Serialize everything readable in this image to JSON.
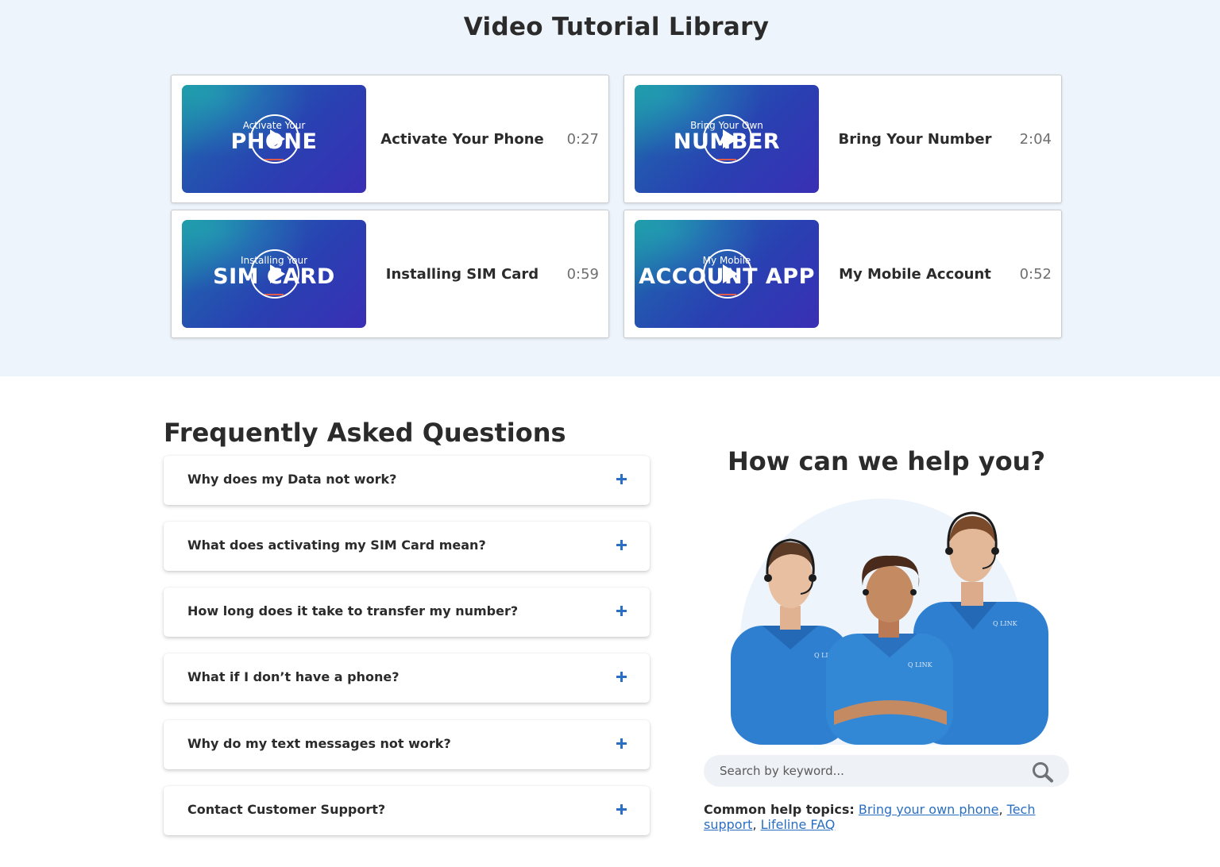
{
  "video_library": {
    "title": "Video Tutorial Library",
    "videos": [
      {
        "thumb_small": "Activate Your",
        "thumb_big": "PHONE",
        "name": "Activate Your Phone",
        "duration": "0:27"
      },
      {
        "thumb_small": "Bring Your Own",
        "thumb_big": "NUMBER",
        "name": "Bring Your Number",
        "duration": "2:04"
      },
      {
        "thumb_small": "Installing Your",
        "thumb_big": "SIM CARD",
        "name": "Installing SIM Card",
        "duration": "0:59"
      },
      {
        "thumb_small": "My Mobile",
        "thumb_big": "ACCOUNT APP",
        "name": "My Mobile Account",
        "duration": "0:52"
      }
    ]
  },
  "faq": {
    "title": "Frequently Asked Questions",
    "items": [
      "Why does my Data not work?",
      "What does activating my SIM Card mean?",
      "How long does it take to transfer my number?",
      "What if I don’t have a phone?",
      "Why do my text messages not work?",
      "Contact Customer Support?"
    ]
  },
  "help": {
    "title": "How can we help you?",
    "search_placeholder": "Search by keyword...",
    "topics_label": "Common help topics:",
    "topics": [
      "Bring your own phone",
      "Tech support",
      "Lifeline FAQ"
    ],
    "shirt_logo": "Q LINK"
  },
  "colors": {
    "section_bg": "#eef4fb",
    "accent": "#2a6fc2",
    "thumb_gradient": [
      "#1a8fa0",
      "#2a3fb2",
      "#3a2fb5"
    ]
  }
}
